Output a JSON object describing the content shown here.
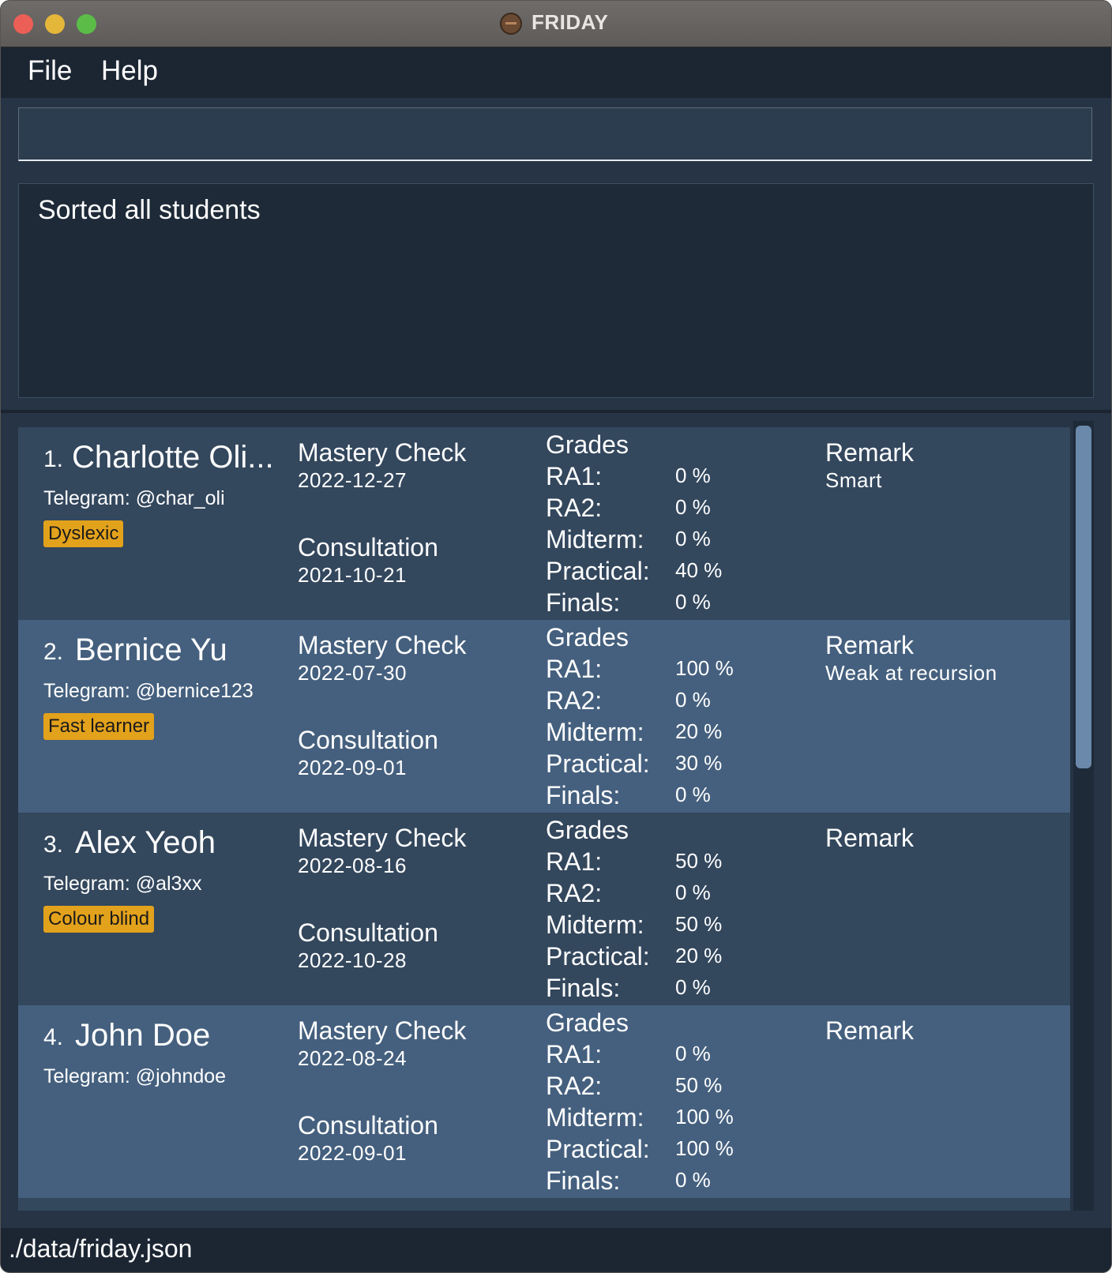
{
  "window": {
    "title": "FRIDAY"
  },
  "menu": {
    "file": "File",
    "help": "Help"
  },
  "command": {
    "value": "",
    "placeholder": ""
  },
  "result": {
    "message": "Sorted all students"
  },
  "students": [
    {
      "index": "1.",
      "name": "Charlotte Oli...",
      "telegram": "Telegram: @char_oli",
      "tag": "Dyslexic",
      "mastery_label": "Mastery Check",
      "mastery_date": "2022-12-27",
      "consultation_label": "Consultation",
      "consultation_date": "2021-10-21",
      "grades_label": "Grades",
      "grades": {
        "ra1": "0 %",
        "ra2": "0 %",
        "midterm": "0 %",
        "practical": "40 %",
        "finals": "0 %"
      },
      "remark_label": "Remark",
      "remark": "Smart"
    },
    {
      "index": "2.",
      "name": "Bernice Yu",
      "telegram": "Telegram: @bernice123",
      "tag": "Fast learner",
      "mastery_label": "Mastery Check",
      "mastery_date": "2022-07-30",
      "consultation_label": "Consultation",
      "consultation_date": "2022-09-01",
      "grades_label": "Grades",
      "grades": {
        "ra1": "100 %",
        "ra2": "0 %",
        "midterm": "20 %",
        "practical": "30 %",
        "finals": "0 %"
      },
      "remark_label": "Remark",
      "remark": "Weak at recursion"
    },
    {
      "index": "3.",
      "name": "Alex Yeoh",
      "telegram": "Telegram: @al3xx",
      "tag": "Colour blind",
      "mastery_label": "Mastery Check",
      "mastery_date": "2022-08-16",
      "consultation_label": "Consultation",
      "consultation_date": "2022-10-28",
      "grades_label": "Grades",
      "grades": {
        "ra1": "50 %",
        "ra2": "0 %",
        "midterm": "50 %",
        "practical": "20 %",
        "finals": "0 %"
      },
      "remark_label": "Remark",
      "remark": ""
    },
    {
      "index": "4.",
      "name": "John Doe",
      "telegram": "Telegram: @johndoe",
      "tag": "",
      "mastery_label": "Mastery Check",
      "mastery_date": "2022-08-24",
      "consultation_label": "Consultation",
      "consultation_date": "2022-09-01",
      "grades_label": "Grades",
      "grades": {
        "ra1": "0 %",
        "ra2": "50 %",
        "midterm": "100 %",
        "practical": "100 %",
        "finals": "0 %"
      },
      "remark_label": "Remark",
      "remark": ""
    }
  ],
  "grade_labels": {
    "ra1": "RA1:",
    "ra2": "RA2:",
    "midterm": "Midterm:",
    "practical": "Practical:",
    "finals": "Finals:"
  },
  "status": {
    "path": "./data/friday.json"
  },
  "colors": {
    "tag": "#e3a21c",
    "card_odd": "#33475d",
    "card_even": "#45607e"
  },
  "icons": {
    "app": "friday-app-icon"
  }
}
